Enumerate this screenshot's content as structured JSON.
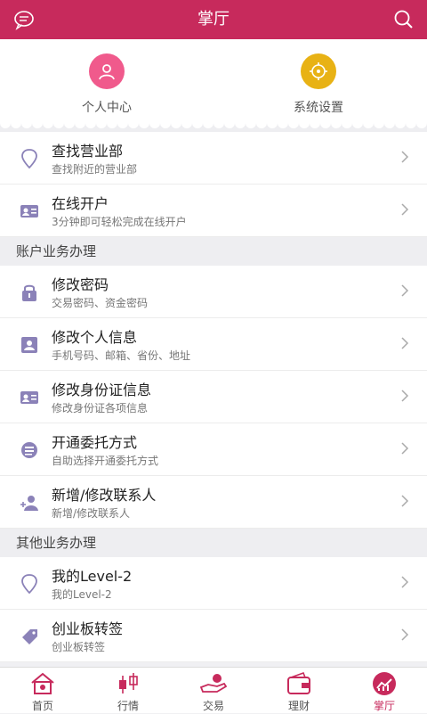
{
  "header": {
    "title": "掌厅"
  },
  "shortcuts": [
    {
      "label": "个人中心",
      "color": "#f05a8c"
    },
    {
      "label": "系统设置",
      "color": "#e8b215"
    }
  ],
  "top_items": [
    {
      "title": "查找营业部",
      "subtitle": "查找附近的营业部"
    },
    {
      "title": "在线开户",
      "subtitle": "3分钟即可轻松完成在线开户"
    }
  ],
  "section1": {
    "label": "账户业务办理"
  },
  "account_items": [
    {
      "title": "修改密码",
      "subtitle": "交易密码、资金密码"
    },
    {
      "title": "修改个人信息",
      "subtitle": "手机号码、邮箱、省份、地址"
    },
    {
      "title": "修改身份证信息",
      "subtitle": "修改身份证各项信息"
    },
    {
      "title": "开通委托方式",
      "subtitle": "自助选择开通委托方式"
    },
    {
      "title": "新增/修改联系人",
      "subtitle": "新增/修改联系人"
    }
  ],
  "section2": {
    "label": "其他业务办理"
  },
  "other_items": [
    {
      "title": "我的Level-2",
      "subtitle": "我的Level-2"
    },
    {
      "title": "创业板转签",
      "subtitle": "创业板转签"
    }
  ],
  "tabs": [
    {
      "label": "首页"
    },
    {
      "label": "行情"
    },
    {
      "label": "交易"
    },
    {
      "label": "理财"
    },
    {
      "label": "掌厅",
      "active": true
    }
  ],
  "colors": {
    "brand": "#c72a5c",
    "icon": "#8b82b8"
  }
}
